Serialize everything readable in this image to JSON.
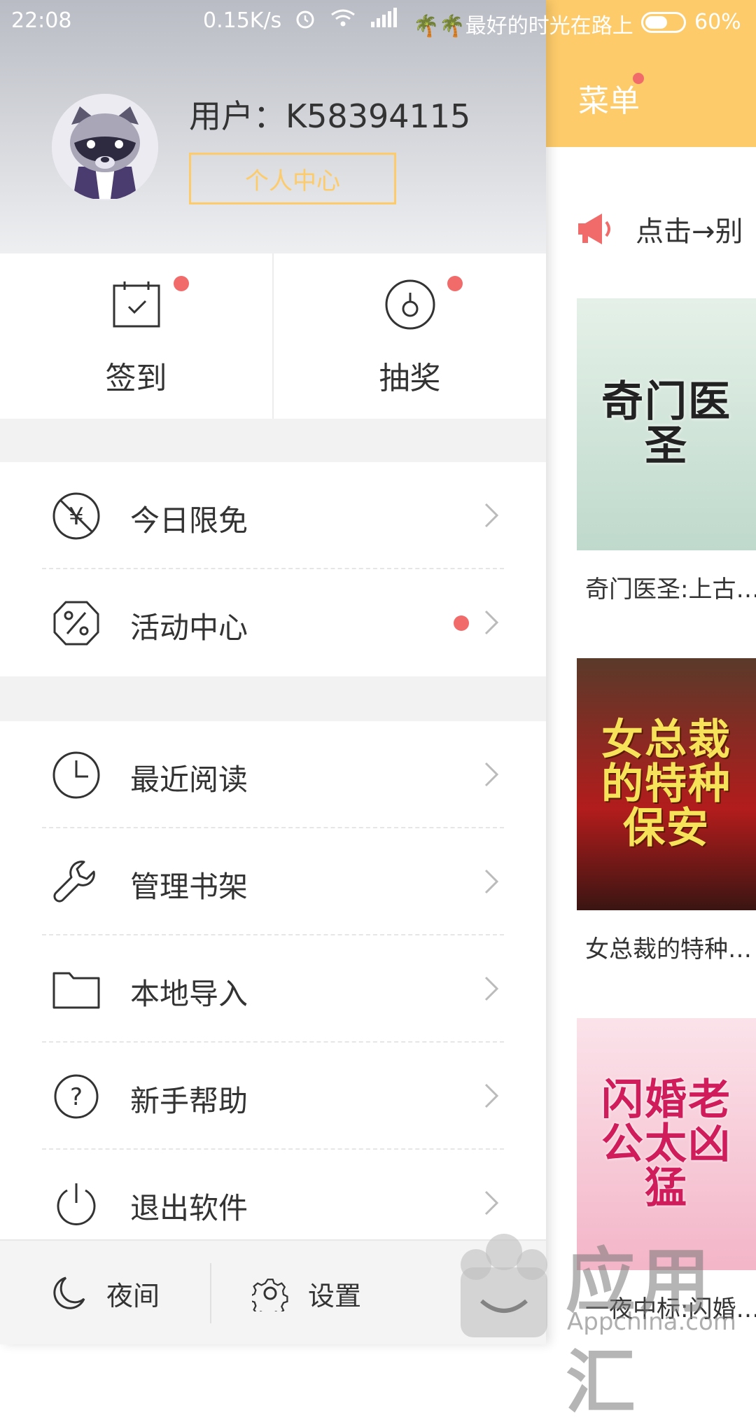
{
  "status_bar": {
    "time": "22:08",
    "speed": "0.15K/s",
    "message": "🌴🌴最好的时光在路上",
    "battery": "60%",
    "battery_level": 0.6
  },
  "profile": {
    "username": "用户：K58394115",
    "center_button": "个人中心"
  },
  "quick_actions": [
    {
      "label": "签到",
      "icon": "calendar-check-icon",
      "badge": true
    },
    {
      "label": "抽奖",
      "icon": "lottery-dial-icon",
      "badge": true
    }
  ],
  "menu_group_1": [
    {
      "label": "今日限免",
      "icon": "no-yen-icon",
      "badge": false
    },
    {
      "label": "活动中心",
      "icon": "percent-badge-icon",
      "badge": true
    }
  ],
  "menu_group_2": [
    {
      "label": "最近阅读",
      "icon": "clock-icon"
    },
    {
      "label": "管理书架",
      "icon": "wrench-icon"
    },
    {
      "label": "本地导入",
      "icon": "folder-icon"
    },
    {
      "label": "新手帮助",
      "icon": "help-circle-icon"
    },
    {
      "label": "退出软件",
      "icon": "power-icon"
    }
  ],
  "bottom_bar": {
    "night": "夜间",
    "settings": "设置"
  },
  "right_pane": {
    "title": "菜单",
    "notice": "点击→别",
    "books": [
      {
        "cover_title": "奇门医圣",
        "title": "奇门医圣:上古…"
      },
      {
        "cover_title": "女总裁的特种保安",
        "title": "女总裁的特种…"
      },
      {
        "cover_title": "闪婚老公太凶猛",
        "title": "一夜中标:闪婚…"
      }
    ]
  },
  "watermark": {
    "text": "应用汇",
    "sub": "Appchina.com"
  },
  "colors": {
    "accent": "#fdcb6a",
    "badge": "#f26b6b",
    "text": "#333333"
  }
}
